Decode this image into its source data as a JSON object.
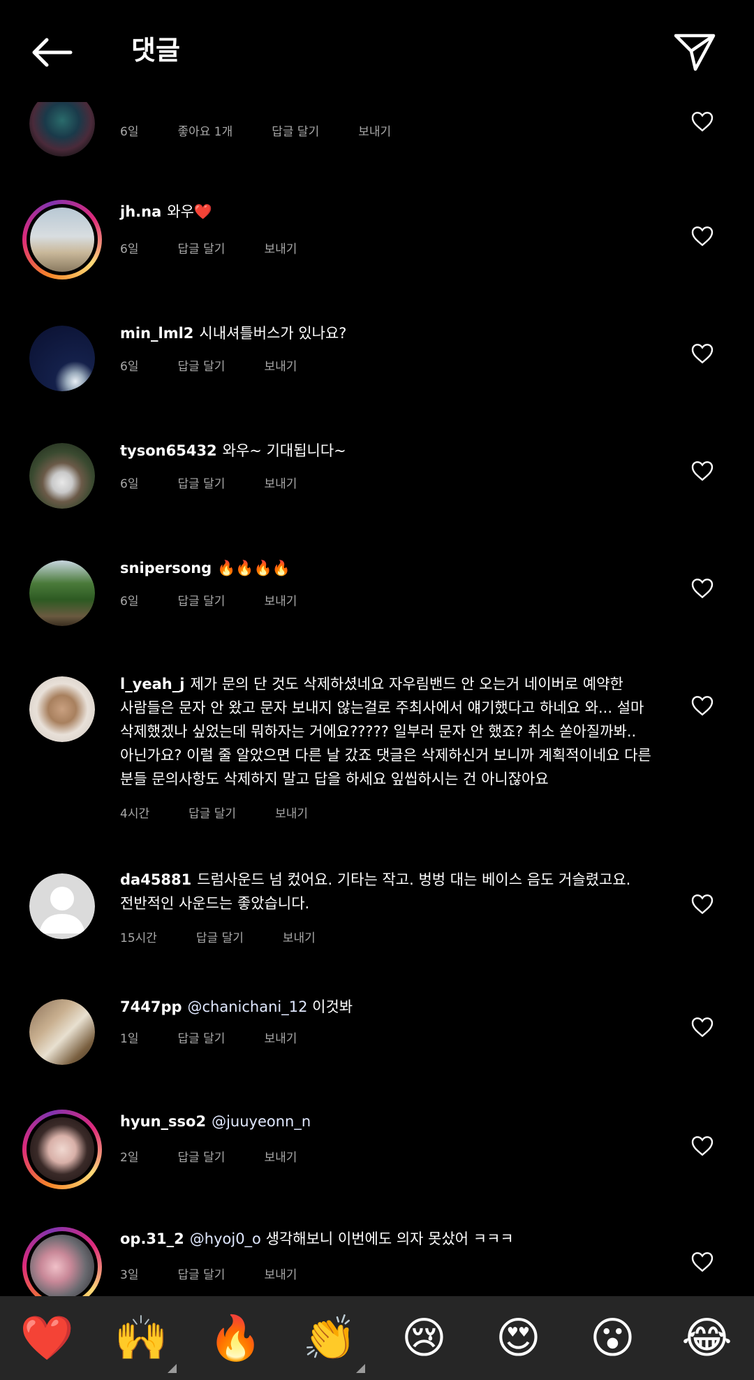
{
  "header": {
    "title": "댓글",
    "back_icon": "arrow-left-icon",
    "share_icon": "paper-plane-icon"
  },
  "comments": [
    {
      "username": "",
      "text": "",
      "time": "6일",
      "likes": "좋아요 1개",
      "reply": "답글 달기",
      "send": "보내기",
      "story": false
    },
    {
      "username": "jh.na",
      "text": "와우❤️",
      "time": "6일",
      "reply": "답글 달기",
      "send": "보내기",
      "story": true
    },
    {
      "username": "min_lml2",
      "text": "시내셔틀버스가 있나요?",
      "time": "6일",
      "reply": "답글 달기",
      "send": "보내기",
      "story": false
    },
    {
      "username": "tyson65432",
      "text": "와우~ 기대됩니다~",
      "time": "6일",
      "reply": "답글 달기",
      "send": "보내기",
      "story": false
    },
    {
      "username": "snipersong",
      "text": "🔥🔥🔥🔥",
      "time": "6일",
      "reply": "답글 달기",
      "send": "보내기",
      "story": false
    },
    {
      "username": "l_yeah_j",
      "text": "제가 문의 단 것도 삭제하셨네요 자우림밴드 안 오는거  네이버로 예약한 사람들은 문자 안 왔고 문자 보내지 않는걸로 주최사에서 얘기했다고 하네요 와... 설마 삭제했겠나 싶었는데 뭐하자는 거에요????? 일부러 문자 안 했죠? 취소 쏟아질까봐.. 아닌가요? 이럴 줄 알았으면 다른 날 갔죠 댓글은 삭제하신거 보니까 계획적이네요 다른 분들 문의사항도 삭제하지 말고 답을 하세요 잎씹하시는 건 아니잖아요",
      "time": "4시간",
      "reply": "답글 달기",
      "send": "보내기",
      "story": false
    },
    {
      "username": "da45881",
      "text": "드럼사운드 넘 컸어요. 기타는 작고. 벙벙 대는 베이스 음도 거슬렸고요. 전반적인 사운드는 좋았습니다.",
      "time": "15시간",
      "reply": "답글 달기",
      "send": "보내기",
      "story": false
    },
    {
      "username": "7447pp",
      "mention": "@chanichani_12",
      "text": "이것봐",
      "time": "1일",
      "reply": "답글 달기",
      "send": "보내기",
      "story": false
    },
    {
      "username": "hyun_sso2",
      "mention": "@juuyeonn_n",
      "text": "",
      "time": "2일",
      "reply": "답글 달기",
      "send": "보내기",
      "story": true
    },
    {
      "username": "op.31_2",
      "mention": "@hyoj0_o",
      "text": "생각해보니 이번에도 의자 못샀어 ㅋㅋㅋ",
      "time": "3일",
      "reply": "답글 달기",
      "send": "보내기",
      "story": true
    }
  ],
  "reactions": [
    {
      "emoji": "❤️",
      "name": "heart-emoji",
      "has_variants": false
    },
    {
      "emoji": "🙌",
      "name": "raising-hands-emoji",
      "has_variants": true
    },
    {
      "emoji": "🔥",
      "name": "fire-emoji",
      "has_variants": false
    },
    {
      "emoji": "👏",
      "name": "clapping-hands-emoji",
      "has_variants": true
    },
    {
      "emoji": "😢",
      "name": "crying-face-emoji",
      "has_variants": false
    },
    {
      "emoji": "😍",
      "name": "heart-eyes-emoji",
      "has_variants": false
    },
    {
      "emoji": "😮",
      "name": "surprised-face-emoji",
      "has_variants": false
    },
    {
      "emoji": "😂",
      "name": "tears-of-joy-emoji",
      "has_variants": false
    }
  ],
  "colors": {
    "background": "#000000",
    "meta_text": "#a8a8a8",
    "reaction_bar": "#262626",
    "story_ring_start": "#f58529",
    "story_ring_end": "#dd2a7b"
  }
}
